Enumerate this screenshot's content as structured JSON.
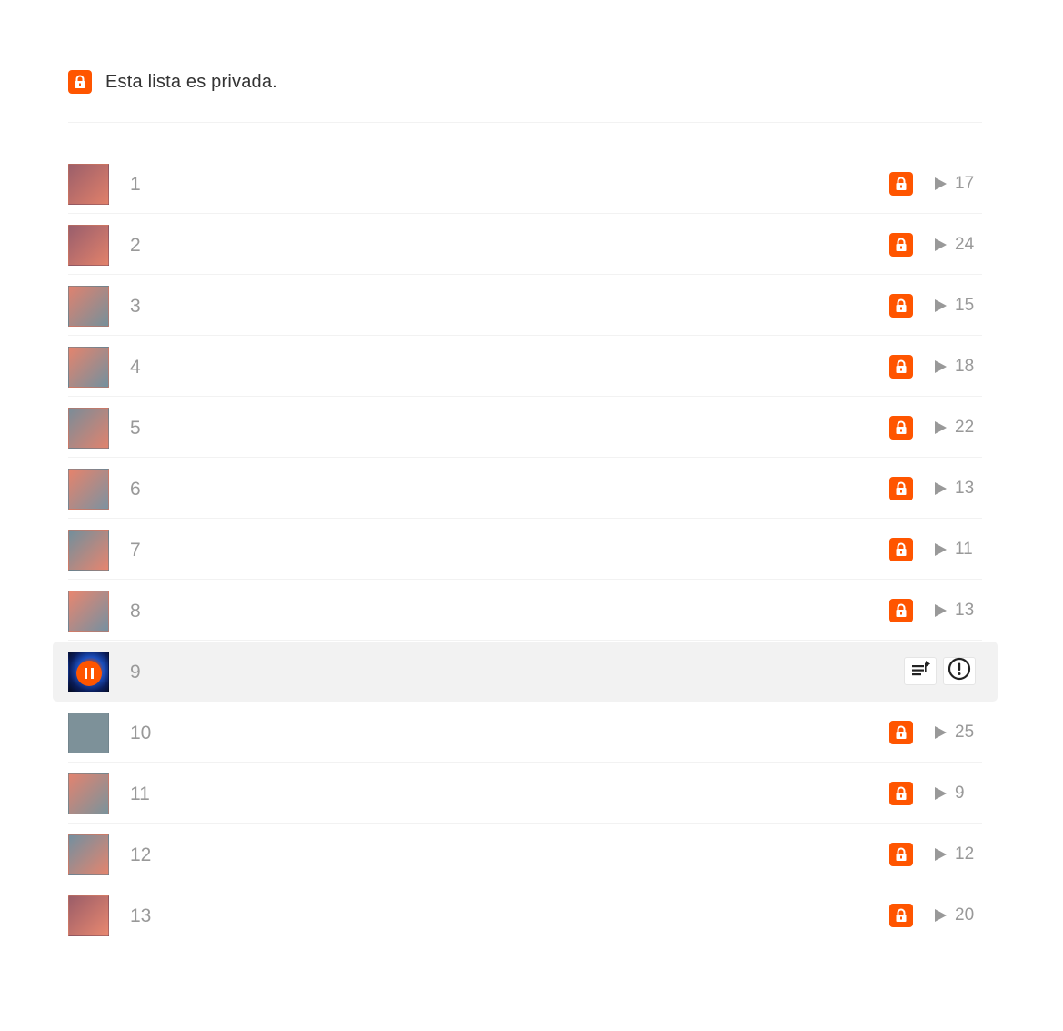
{
  "notice": {
    "text": "Esta lista es privada.",
    "icon": "lock-icon"
  },
  "accent_color": "#ff5500",
  "tracks": [
    {
      "number": "1",
      "plays": "17",
      "private": true,
      "thumb": [
        "#9c5f6a",
        "#e0806a"
      ]
    },
    {
      "number": "2",
      "plays": "24",
      "private": true,
      "thumb": [
        "#995e6c",
        "#e2826b"
      ]
    },
    {
      "number": "3",
      "plays": "15",
      "private": true,
      "thumb": [
        "#de8270",
        "#76909a"
      ]
    },
    {
      "number": "4",
      "plays": "18",
      "private": true,
      "thumb": [
        "#e3846e",
        "#73909e"
      ]
    },
    {
      "number": "5",
      "plays": "22",
      "private": true,
      "thumb": [
        "#7b8c98",
        "#e0836e"
      ]
    },
    {
      "number": "6",
      "plays": "13",
      "private": true,
      "thumb": [
        "#e5836c",
        "#7c92a0"
      ]
    },
    {
      "number": "7",
      "plays": "11",
      "private": true,
      "thumb": [
        "#728f9c",
        "#e6856f"
      ]
    },
    {
      "number": "8",
      "plays": "13",
      "private": true,
      "thumb": [
        "#e78670",
        "#7690a0"
      ]
    },
    {
      "number": "9",
      "playing": true
    },
    {
      "number": "10",
      "plays": "25",
      "private": true,
      "thumb": [
        "#7d9199",
        "#7d9199"
      ]
    },
    {
      "number": "11",
      "plays": "9",
      "private": true,
      "thumb": [
        "#e18370",
        "#7a939b"
      ]
    },
    {
      "number": "12",
      "plays": "12",
      "private": true,
      "thumb": [
        "#748f9f",
        "#e4856e"
      ]
    },
    {
      "number": "13",
      "plays": "20",
      "private": true,
      "thumb": [
        "#9b5d68",
        "#e88870"
      ]
    }
  ],
  "active_row": {
    "actions": [
      {
        "name": "add-to-queue",
        "icon": "add-to-queue-icon"
      },
      {
        "name": "report",
        "icon": "alert-circle-icon"
      }
    ],
    "playing_icon": "pause-icon"
  }
}
